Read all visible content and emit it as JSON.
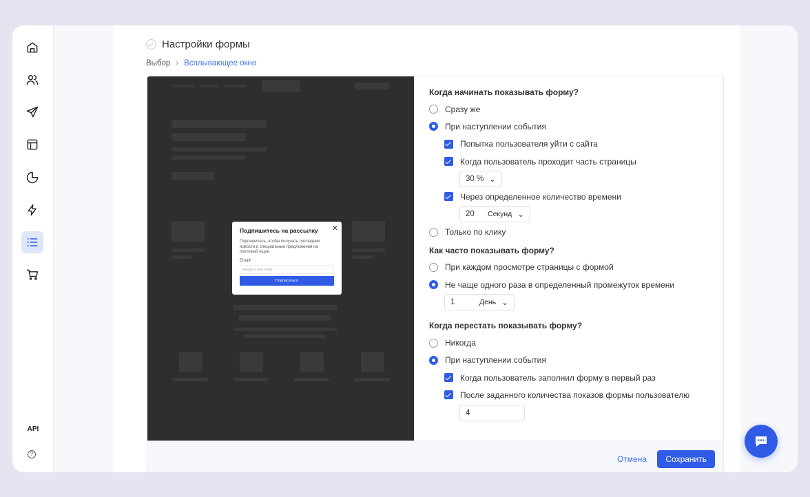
{
  "sidebar": {
    "items": [
      "home",
      "users",
      "campaigns",
      "templates",
      "analytics",
      "automation",
      "forms",
      "ecommerce"
    ],
    "api_label": "API",
    "help_label": "?"
  },
  "header": {
    "title": "Настройки формы",
    "breadcrumb": [
      "Выбор",
      "Всплывающее окно"
    ]
  },
  "preview": {
    "title": "Подпишитесь на рассылку",
    "close": "✕",
    "text": "Подпишитесь, чтобы получать последние новости и специальные предложения на почтовый ящик.",
    "email_label": "Email*",
    "email_placeholder": "Введите ваш email",
    "button": "Подписаться"
  },
  "settings": {
    "q1": "Когда начинать показывать форму?",
    "q1_opts": [
      "Сразу же",
      "При наступлении события"
    ],
    "q1_sub": [
      "Попытка пользователя уйти с сайта",
      "Когда пользователь проходит часть страницы",
      "Через определенное количество времени"
    ],
    "percent": "30 %",
    "time_value": "20",
    "time_unit": "Секунд",
    "q1_last": "Только по клику",
    "q2": "Как часто показывать форму?",
    "q2_opts": [
      "При каждом просмотре страницы с формой",
      "Не чаще одного раза в определенный промежуток времени"
    ],
    "freq_value": "1",
    "freq_unit": "День",
    "q3": "Когда перестать показывать форму?",
    "q3_opts": [
      "Никогда",
      "При наступлении события"
    ],
    "q3_sub": [
      "Когда пользователь заполнил форму в первый раз",
      "После заданного количества показов формы пользователю"
    ],
    "shows_value": "4"
  },
  "footer": {
    "cancel": "Отмена",
    "save": "Сохранить"
  },
  "colors": {
    "accent": "#2f5be6"
  }
}
